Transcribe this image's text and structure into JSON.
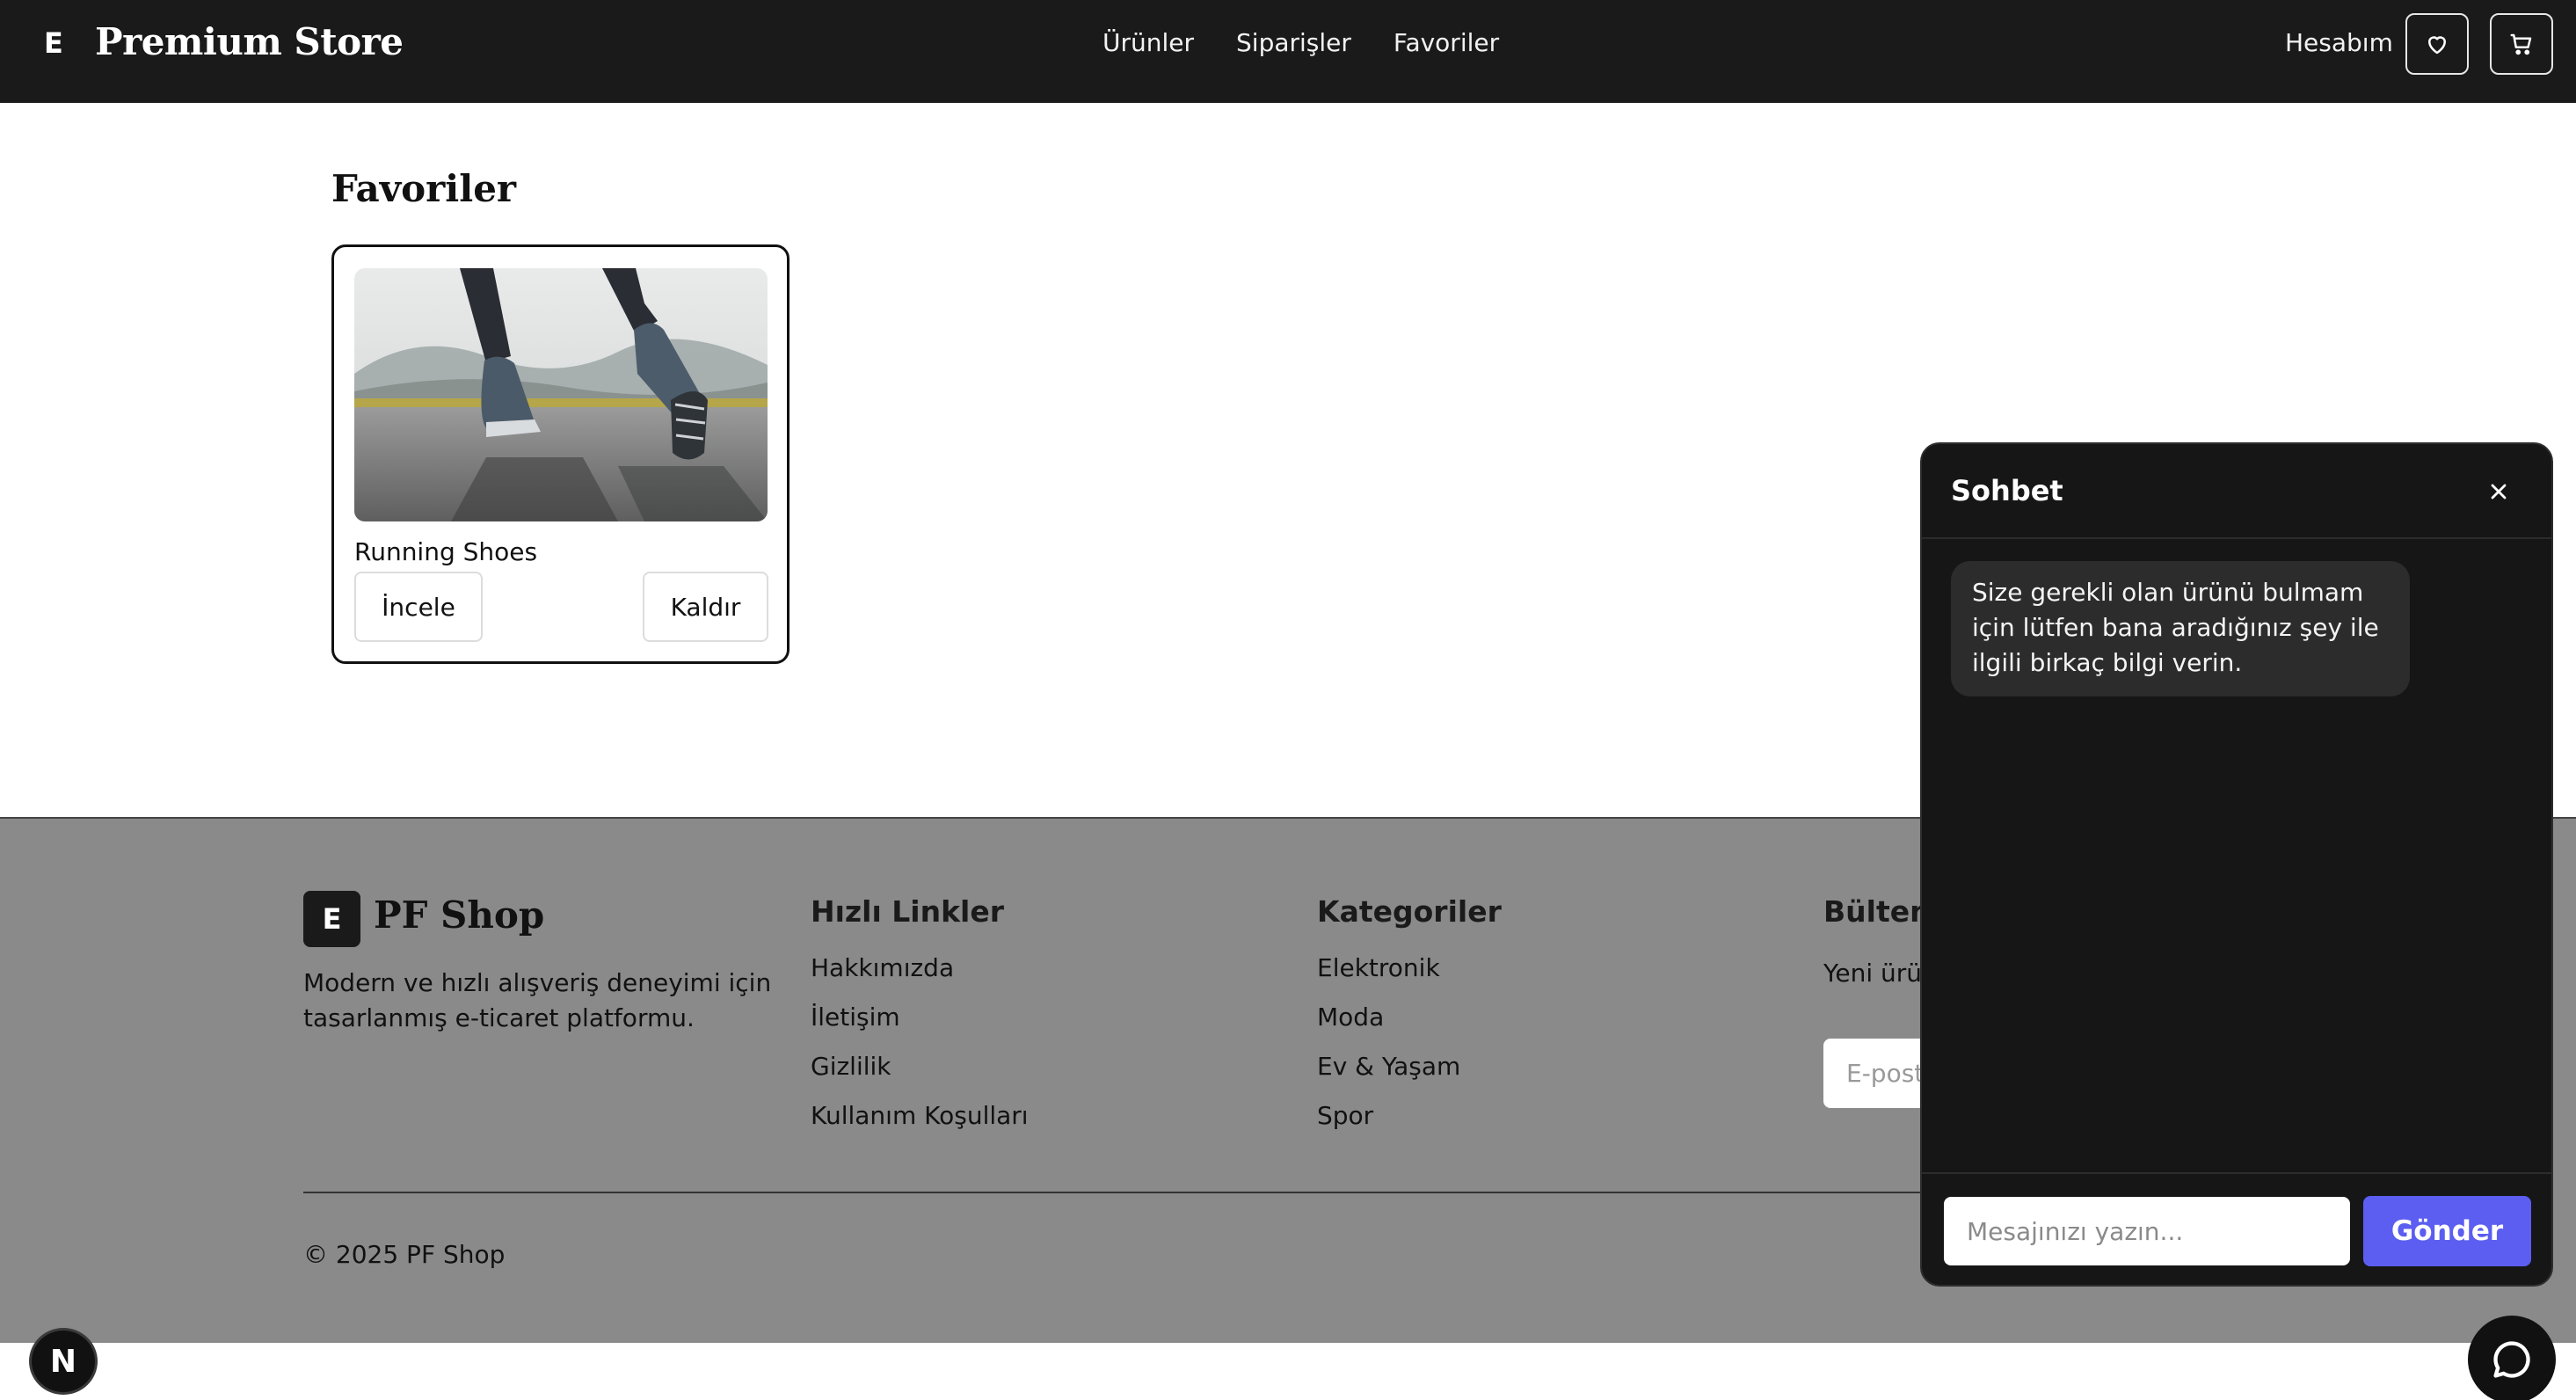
{
  "header": {
    "brand_mark": "E",
    "brand_name": "Premium Store",
    "nav": [
      "Ürünler",
      "Siparişler",
      "Favoriler"
    ],
    "account_label": "Hesabım",
    "icons": [
      "heart-icon",
      "cart-icon"
    ]
  },
  "main": {
    "title": "Favoriler",
    "items": [
      {
        "name": "Running Shoes",
        "review_label": "İncele",
        "remove_label": "Kaldır"
      }
    ]
  },
  "footer": {
    "logo_mark": "E",
    "brand": "PF Shop",
    "description": "Modern ve hızlı alışveriş deneyimi için tasarlanmış e-ticaret platformu.",
    "quick_links_title": "Hızlı Linkler",
    "quick_links": [
      "Hakkımızda",
      "İletişim",
      "Gizlilik",
      "Kullanım Koşulları"
    ],
    "categories_title": "Kategoriler",
    "categories": [
      "Elektronik",
      "Moda",
      "Ev & Yaşam",
      "Spor"
    ],
    "newsletter_title": "Bülten",
    "newsletter_text": "Yeni ürün olun.",
    "newsletter_placeholder": "E-post",
    "copyright": "© 2025 PF Shop"
  },
  "chat": {
    "title": "Sohbet",
    "messages": [
      {
        "from": "bot",
        "text": "Size gerekli olan ürünü bulmam için lütfen bana aradığınız şey ile ilgili birkaç bilgi verin."
      }
    ],
    "input_placeholder": "Mesajınızı yazın...",
    "send_label": "Gönder"
  },
  "floating": {
    "dev_badge": "N",
    "chat_toggle_icon": "chat-bubble-icon"
  },
  "colors": {
    "header_bg": "#1a1a1a",
    "footer_bg": "#8a8a8a",
    "chat_bg": "#161616",
    "send_button": "#5b5ef0"
  }
}
